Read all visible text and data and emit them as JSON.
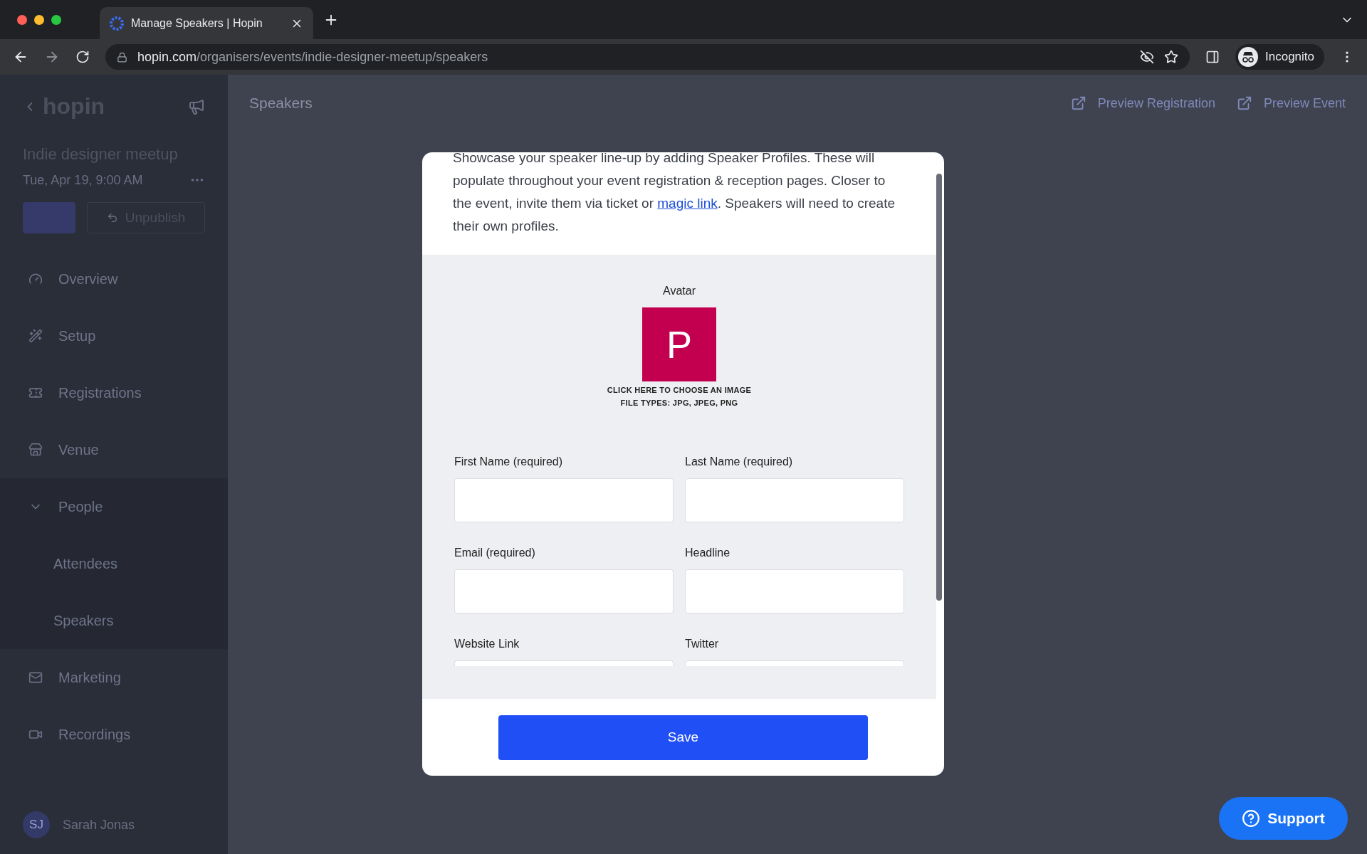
{
  "browser": {
    "tab_title": "Manage Speakers | Hopin",
    "url_host": "hopin.com",
    "url_path": "/organisers/events/indie-designer-meetup/speakers",
    "profile_label": "Incognito"
  },
  "sidebar": {
    "logo": "hopin",
    "event_title": "Indie designer meetup",
    "event_date": "Tue, Apr 19, 9:00 AM",
    "unpublish_label": "Unpublish",
    "nav": [
      {
        "label": "Overview"
      },
      {
        "label": "Setup"
      },
      {
        "label": "Registrations"
      },
      {
        "label": "Venue"
      },
      {
        "label": "People",
        "expanded": true,
        "children": [
          {
            "label": "Attendees"
          },
          {
            "label": "Speakers"
          }
        ]
      },
      {
        "label": "Marketing"
      },
      {
        "label": "Recordings"
      }
    ],
    "user": {
      "initials": "SJ",
      "name": "Sarah Jonas"
    }
  },
  "header": {
    "title": "Speakers",
    "actions": [
      "Preview Registration",
      "Preview Event"
    ]
  },
  "modal": {
    "intro_before": "Showcase your speaker line-up by adding Speaker Profiles. These will populate throughout your event registration & reception pages. Closer to the event, invite them via ticket or ",
    "intro_link": "magic link",
    "intro_after": ". Speakers will need to create their own profiles.",
    "avatar": {
      "label": "Avatar",
      "letter": "P",
      "hint": "CLICK HERE TO CHOOSE AN IMAGE",
      "file_types": "FILE TYPES: JPG, JPEG, PNG"
    },
    "fields": [
      {
        "label": "First Name (required)"
      },
      {
        "label": "Last Name (required)"
      },
      {
        "label": "Email (required)"
      },
      {
        "label": "Headline"
      },
      {
        "label": "Website Link"
      },
      {
        "label": "Twitter"
      }
    ],
    "save_label": "Save"
  },
  "support_label": "Support"
}
